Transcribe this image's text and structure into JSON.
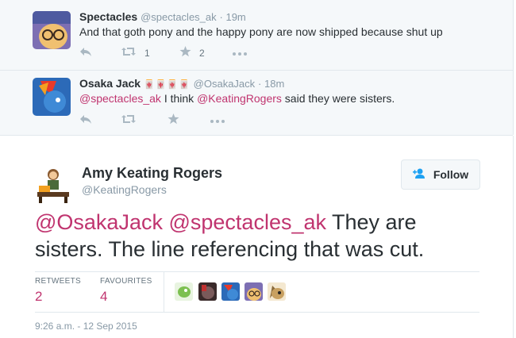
{
  "replies": [
    {
      "name": "Spectacles",
      "handle": "@spectacles_ak",
      "time": "· 19m",
      "text": "And that goth pony and the happy pony are now shipped because shut up",
      "retweets": "1",
      "favourites": "2"
    },
    {
      "name": "Osaka Jack",
      "name_glyphs": "🀄🀄🀄🀄",
      "handle": "@OsakaJack",
      "time": "· 18m",
      "mention1": "@spectacles_ak",
      "text_mid": " I think ",
      "mention2": "@KeatingRogers",
      "text_end": " said they were sisters."
    }
  ],
  "focus": {
    "name": "Amy Keating Rogers",
    "handle": "@KeatingRogers",
    "follow_label": "Follow",
    "mention1": "@OsakaJack",
    "mention2": "@spectacles_ak",
    "text": " They are sisters. The line referencing that was cut.",
    "retweets_label": "RETWEETS",
    "retweets": "2",
    "favourites_label": "FAVOURITES",
    "favourites": "4",
    "timestamp": "9:26 a.m. - 12 Sep 2015"
  },
  "colors": {
    "mention": "#c0346f",
    "muted": "#8899a6",
    "thread_bg": "#f5f8fa"
  },
  "icons": [
    "reply-icon",
    "retweet-icon",
    "favourite-icon",
    "more-icon",
    "follow-person-icon"
  ]
}
